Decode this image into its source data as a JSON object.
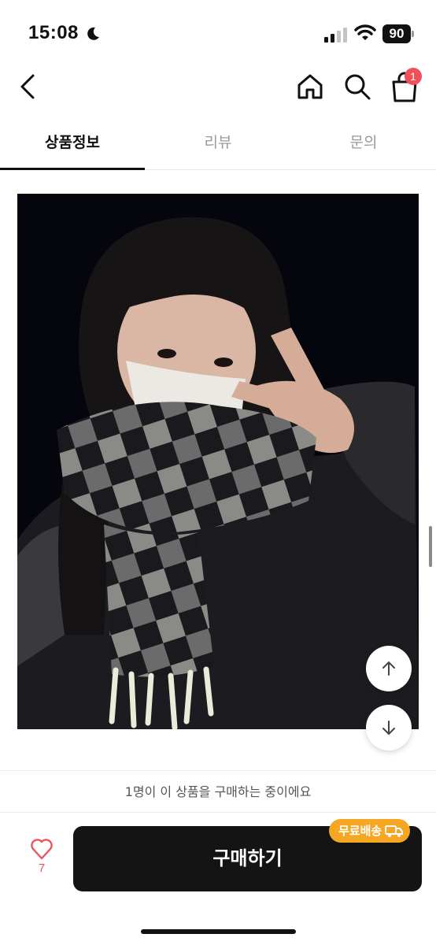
{
  "status_bar": {
    "time": "15:08",
    "battery": "90"
  },
  "header": {
    "cart_count": "1"
  },
  "tabs": [
    {
      "label": "상품정보",
      "active": true
    },
    {
      "label": "리뷰",
      "active": false
    },
    {
      "label": "문의",
      "active": false
    }
  ],
  "buying_now_text": "1명이 이 상품을 구매하는 중이에요",
  "bottom": {
    "like_count": "7",
    "buy_label": "구매하기",
    "free_shipping_label": "무료배송"
  },
  "colors": {
    "accent_red": "#f0505a",
    "badge_orange": "#f5a623",
    "button_dark": "#141414"
  }
}
